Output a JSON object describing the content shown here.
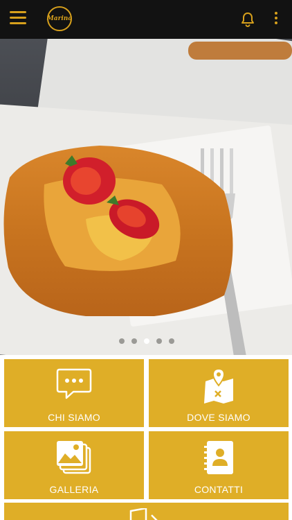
{
  "header": {
    "logo_text": "Marina",
    "icons": [
      "menu-icon",
      "bell-icon",
      "more-vertical-icon"
    ]
  },
  "carousel": {
    "total_slides": 5,
    "active_slide": 3
  },
  "tiles": [
    {
      "label": "CHI SIAMO",
      "icon": "chat-bubble-icon"
    },
    {
      "label": "DOVE SIAMO",
      "icon": "map-pin-icon"
    },
    {
      "label": "GALLERIA",
      "icon": "gallery-icon"
    },
    {
      "label": "CONTATTI",
      "icon": "contacts-book-icon"
    },
    {
      "label": "",
      "icon": "exit-door-icon"
    }
  ],
  "colors": {
    "accent": "#dfae27",
    "topbar": "#121212",
    "icon_gold": "#d7a01c"
  }
}
